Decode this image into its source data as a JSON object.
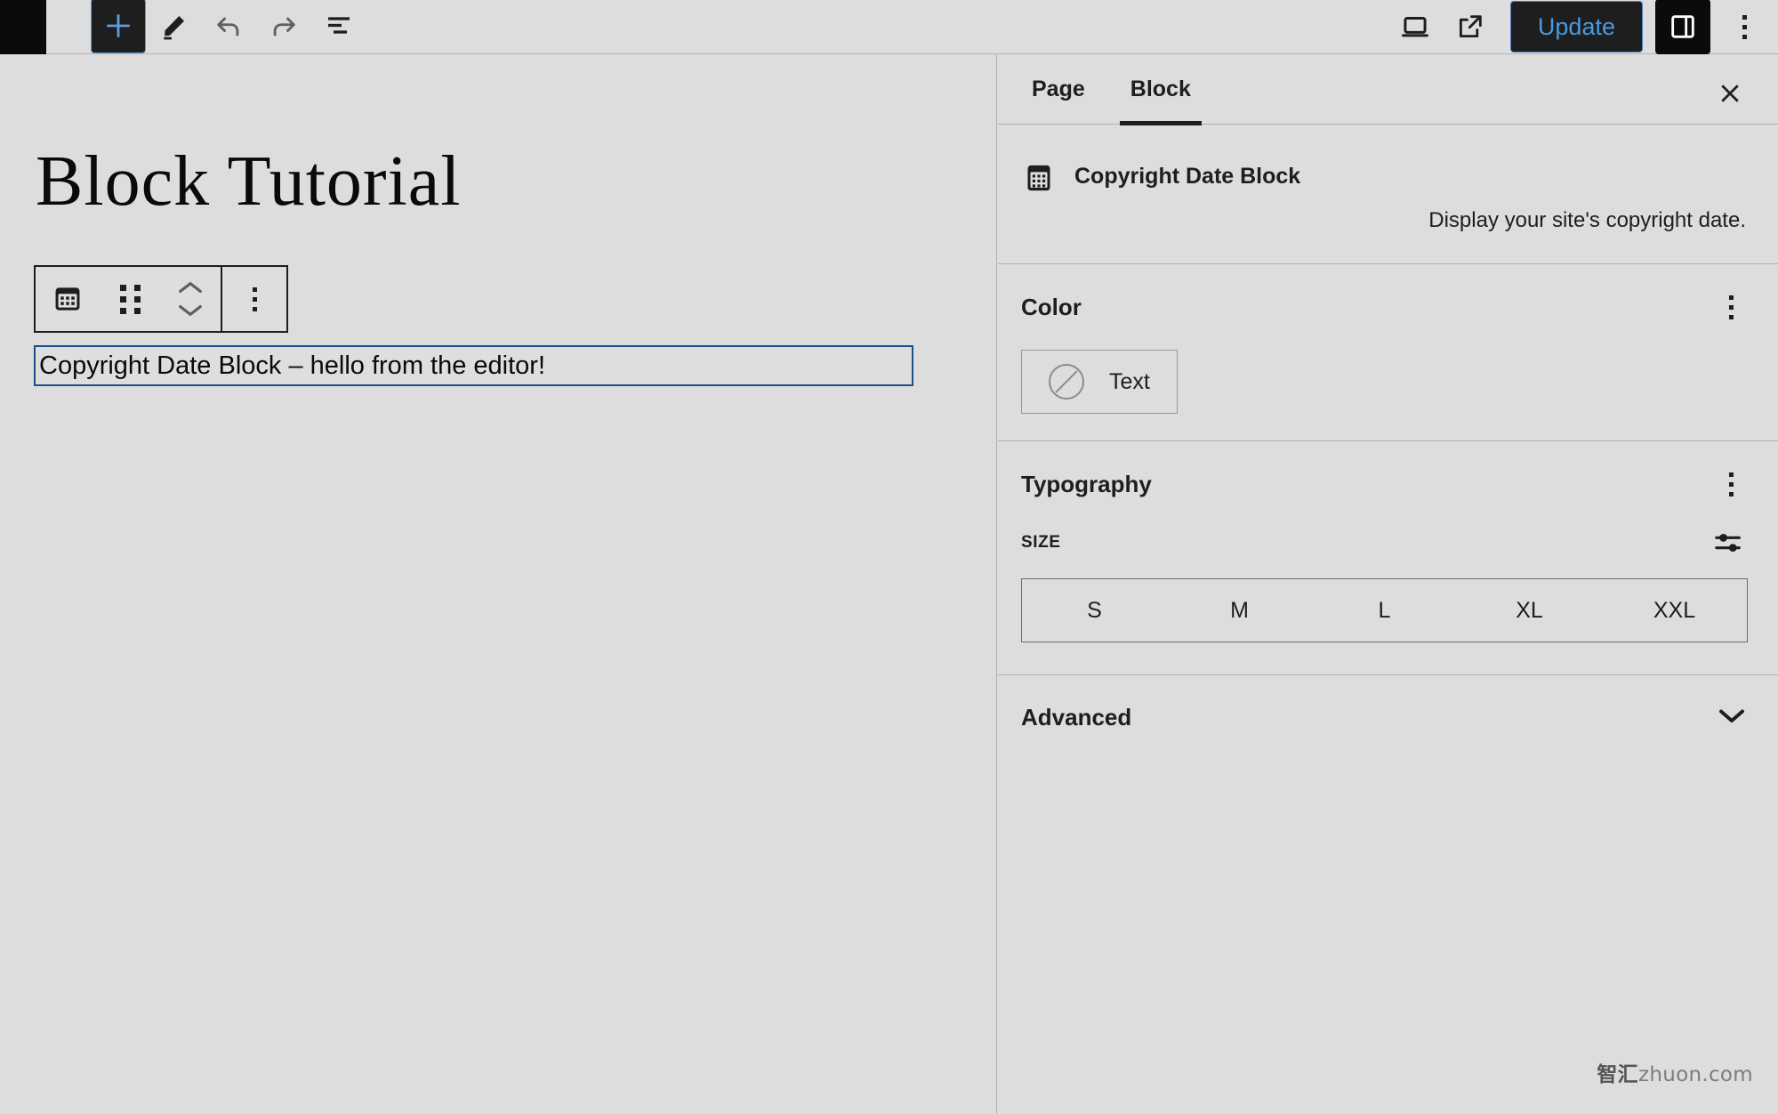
{
  "toolbar": {
    "logo_icon": "wordpress-logo-icon",
    "add_block_label": "+",
    "add_block_icon": "plus-icon",
    "edit_icon": "pencil-icon",
    "undo_icon": "undo-arrow-icon",
    "redo_icon": "redo-arrow-icon",
    "list_view_icon": "list-view-icon",
    "view_icon": "desktop-preview-icon",
    "external_icon": "external-link-icon",
    "update_label": "Update",
    "sidebar_toggle_icon": "settings-sidebar-icon",
    "options_icon": "three-dots-vertical-icon",
    "accent_blue": "#4a9ae0",
    "dark": "#1e1e1e"
  },
  "canvas": {
    "post_title": "Block Tutorial",
    "block_toolbar": {
      "block_type_icon": "calendar-icon",
      "drag_handle_icon": "six-dots-drag-icon",
      "move_up_icon": "chevron-up-icon",
      "move_down_icon": "chevron-down-icon",
      "more_options_icon": "three-dots-vertical-icon"
    },
    "selected_block": {
      "text": "Copyright Date Block – hello from the editor!",
      "selection_color": "#1b4f8a"
    }
  },
  "sidebar": {
    "tabs": [
      {
        "label": "Page",
        "active": false
      },
      {
        "label": "Block",
        "active": true
      }
    ],
    "close_icon": "close-x-icon",
    "block_info": {
      "icon": "calendar-icon",
      "title": "Copyright Date Block",
      "description": "Display your site's copyright date."
    },
    "color_section": {
      "title": "Color",
      "more_icon": "three-dots-vertical-icon",
      "items": [
        {
          "label": "Text",
          "swatch": "none",
          "swatch_icon": "no-color-circle-icon"
        }
      ]
    },
    "typography_section": {
      "title": "Typography",
      "more_icon": "three-dots-vertical-icon",
      "size_label": "SIZE",
      "size_settings_icon": "sliders-icon",
      "size_options": [
        "S",
        "M",
        "L",
        "XL",
        "XXL"
      ],
      "selected_size": null
    },
    "advanced_section": {
      "title": "Advanced",
      "chevron_icon": "chevron-down-icon"
    }
  },
  "watermark": {
    "cn": "智汇",
    "domain": "zhuon.com"
  }
}
